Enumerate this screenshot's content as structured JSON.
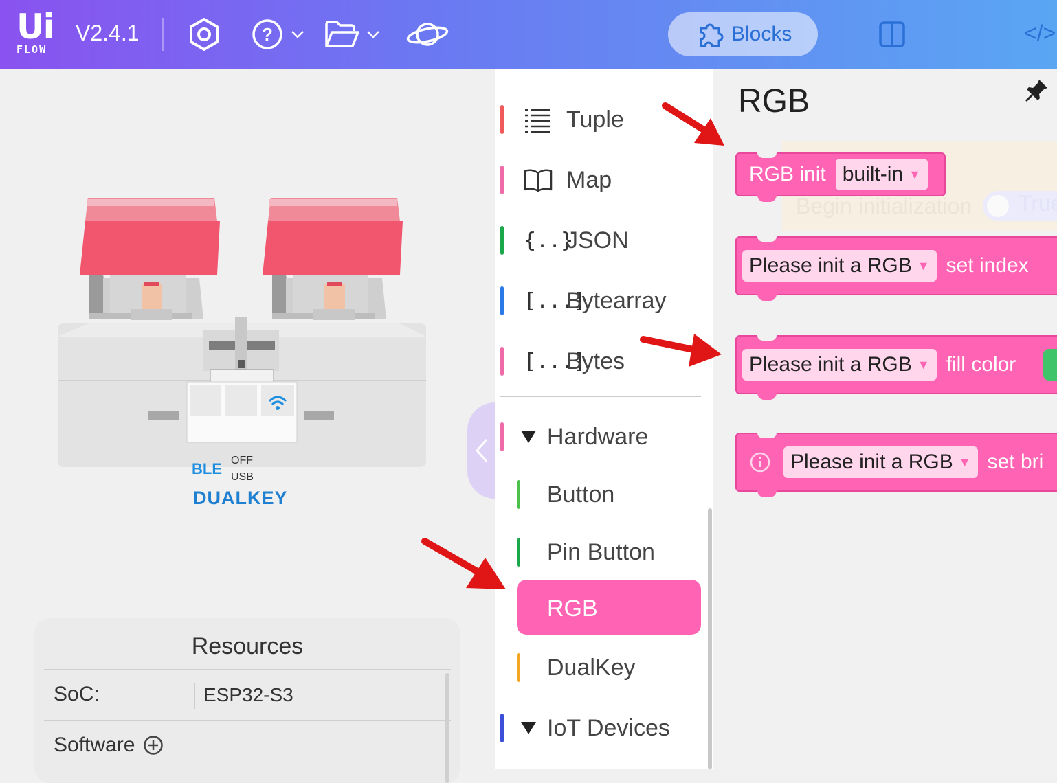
{
  "header": {
    "logo_top": "Ui",
    "logo_bottom": "FLOW",
    "version": "V2.4.1",
    "icons": [
      "settings-icon",
      "help-icon",
      "folder-icon",
      "planet-icon"
    ],
    "tabs": {
      "blocks": "Blocks",
      "split": "split-view-icon",
      "code": "</>"
    },
    "accent": "#2a6fd6"
  },
  "device": {
    "ble_label": "BLE",
    "off_label": "OFF",
    "usb_label": "USB",
    "name_label": "DUALKEY",
    "key_color": "#f2566e"
  },
  "resources": {
    "title": "Resources",
    "rows": [
      {
        "key": "SoC:",
        "value": "ESP32-S3"
      },
      {
        "key": "Software",
        "value": ""
      }
    ]
  },
  "menu": {
    "items": [
      {
        "label": "Tuple",
        "glyph": "☰",
        "color": "#f05a5a"
      },
      {
        "label": "Map",
        "glyph": "🕮",
        "color": "#f06aa8"
      },
      {
        "label": "JSON",
        "glyph": "{..}",
        "color": "#1aa84a"
      },
      {
        "label": "Bytearray",
        "glyph": "[...]",
        "color": "#2a7ae8"
      },
      {
        "label": "Bytes",
        "glyph": "[...]",
        "color": "#f06aa8"
      }
    ],
    "hardware": {
      "label": "Hardware",
      "color": "#f06aa8",
      "children": [
        {
          "label": "Button",
          "color": "#4cc14c"
        },
        {
          "label": "Pin Button",
          "color": "#1aa84a"
        },
        {
          "label": "RGB",
          "color": "#ff63b4"
        },
        {
          "label": "DualKey",
          "color": "#f5a623"
        }
      ]
    },
    "iot": {
      "label": "IoT Devices",
      "color": "#3b4fd8"
    }
  },
  "flyout": {
    "title": "RGB",
    "ghost_text": "Begin initialization",
    "ghost_toggle": "True",
    "blocks": [
      {
        "prefix": "RGB init",
        "dropdown": "built-in",
        "suffix": ""
      },
      {
        "prefix": "",
        "dropdown": "Please init a RGB",
        "suffix": "set index"
      },
      {
        "prefix": "",
        "dropdown": "Please init a RGB",
        "suffix": "fill color"
      },
      {
        "prefix": "",
        "dropdown": "Please init a RGB",
        "suffix": "set bri"
      }
    ],
    "block_color": "#ff63b4"
  }
}
